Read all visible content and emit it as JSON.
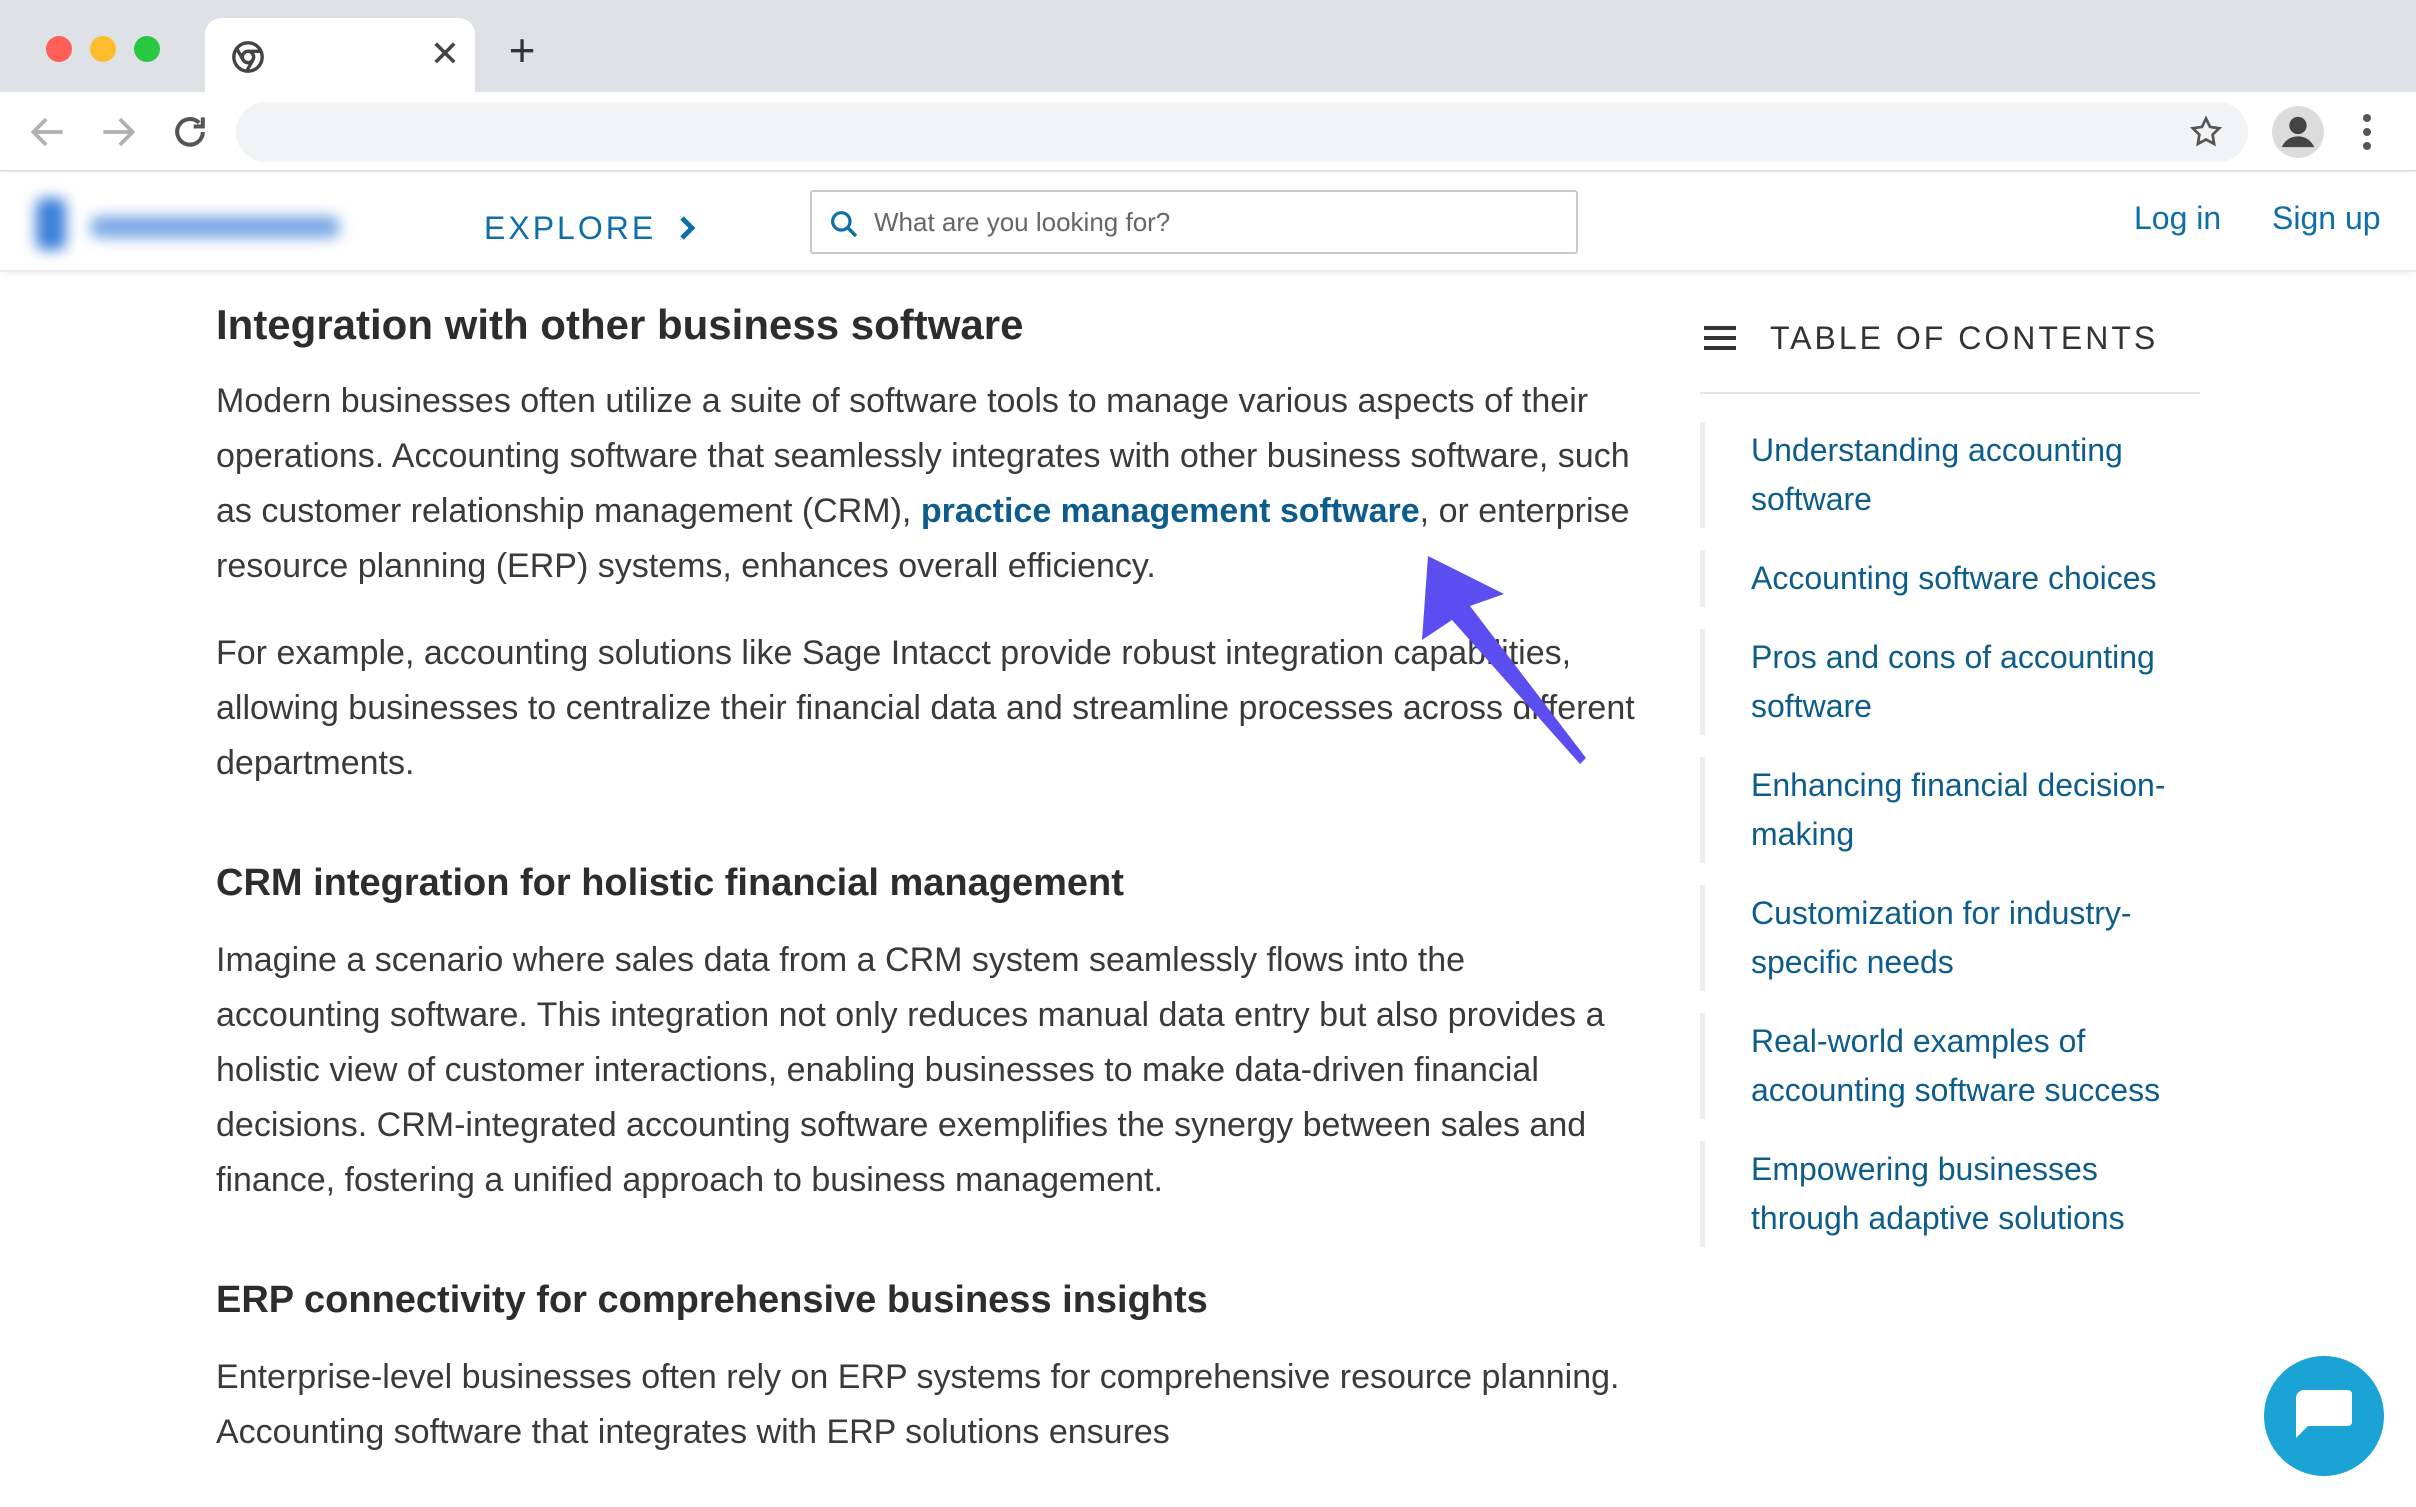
{
  "browser": {
    "tab_close": "✕",
    "new_tab": "+",
    "address": ""
  },
  "header": {
    "explore_label": "EXPLORE",
    "search_placeholder": "What are you looking for?",
    "login_label": "Log in",
    "signup_label": "Sign up"
  },
  "article": {
    "h1": "Integration with other business software",
    "p1_before": "Modern businesses often utilize a suite of software tools to manage various aspects of their operations. Accounting software that seamlessly integrates with other business software, such as customer relationship management (CRM), ",
    "p1_link": "practice management software",
    "p1_after": ", or enterprise resource planning (ERP) systems, enhances overall efficiency.",
    "p2": "For example, accounting solutions like Sage Intacct provide robust integration capabilities, allowing businesses to centralize their financial data and streamline processes across different departments.",
    "h2": "CRM integration for holistic financial management",
    "p3": "Imagine a scenario where sales data from a CRM system seamlessly flows into the accounting software. This integration not only reduces manual data entry but also provides a holistic view of customer interactions, enabling businesses to make data-driven financial decisions. CRM-integrated accounting software exemplifies the synergy between sales and finance, fostering a unified approach to business management.",
    "h3": "ERP connectivity for comprehensive business insights",
    "p4": "Enterprise-level businesses often rely on ERP systems for comprehensive resource planning. Accounting software that integrates with ERP solutions ensures"
  },
  "toc": {
    "title": "TABLE OF CONTENTS",
    "items": [
      {
        "label": "Understanding accounting software"
      },
      {
        "label": "Accounting software choices"
      },
      {
        "label": "Pros and cons of accounting software"
      },
      {
        "label": "Enhancing financial decision-making"
      },
      {
        "label": "Customization for industry-specific needs"
      },
      {
        "label": "Real-world examples of accounting software success"
      },
      {
        "label": "Empowering businesses through adaptive solutions"
      }
    ]
  },
  "colors": {
    "link": "#0d5d8c",
    "brand": "#0d6ea8",
    "annotation_arrow": "#5b4df0",
    "chat": "#1ba3d6"
  },
  "icons": [
    "chrome-icon",
    "back-icon",
    "forward-icon",
    "reload-icon",
    "star-icon",
    "profile-icon",
    "more-vert-icon",
    "chevron-right-icon",
    "search-icon",
    "hamburger-icon",
    "chat-icon",
    "annotation-arrow-icon"
  ]
}
